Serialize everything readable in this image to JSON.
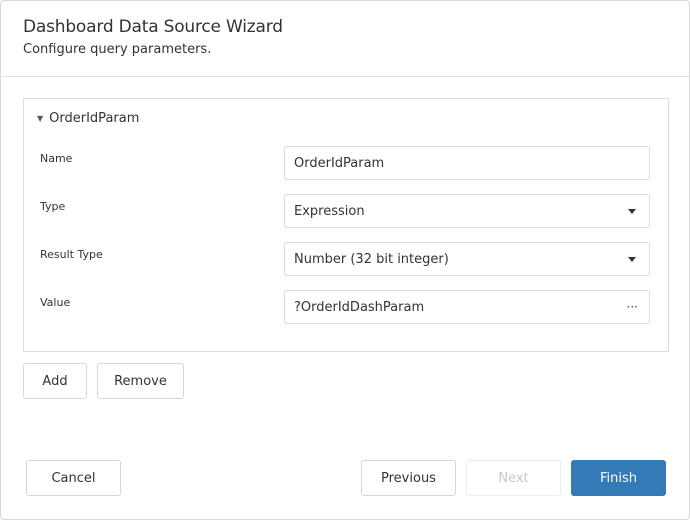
{
  "header": {
    "title": "Dashboard Data Source Wizard",
    "subtitle": "Configure query parameters."
  },
  "parameter": {
    "name": "OrderIdParam",
    "expanded": true,
    "fields": {
      "name": {
        "label": "Name",
        "value": "OrderIdParam"
      },
      "type": {
        "label": "Type",
        "value": "Expression",
        "icon": "chevron-down-icon"
      },
      "result_type": {
        "label": "Result Type",
        "value": "Number (32 bit integer)",
        "icon": "chevron-down-icon"
      },
      "value": {
        "label": "Value",
        "value": "?OrderIdDashParam",
        "icon": "ellipsis-icon"
      }
    }
  },
  "actions": {
    "add": "Add",
    "remove": "Remove"
  },
  "footer": {
    "cancel": "Cancel",
    "previous": "Previous",
    "next": "Next",
    "finish": "Finish",
    "next_disabled": true
  },
  "colors": {
    "primary": "#337ab7",
    "border": "#dddddd",
    "text": "#333333",
    "disabled_text": "#c8c8c8"
  }
}
